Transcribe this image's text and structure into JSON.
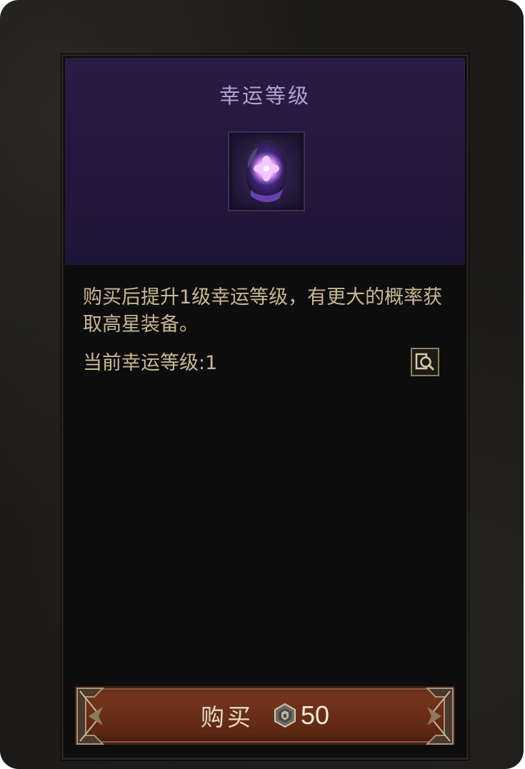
{
  "dialog": {
    "title": "幸运等级",
    "item_icon": "luck-gem-icon",
    "description": "购买后提升1级幸运等级，有更大的概率获取高星装备。",
    "current_level_label": "当前幸运等级:",
    "current_level_value": "1",
    "inspect_icon": "magnifier-icon",
    "buy_button": {
      "label": "购买",
      "currency_icon": "currency-coin-icon",
      "price": "50"
    }
  },
  "colors": {
    "header_purple": "#23173b",
    "title_text": "#b9a0d2",
    "body_text": "#c9b894",
    "button_red": "#6a2e18"
  }
}
